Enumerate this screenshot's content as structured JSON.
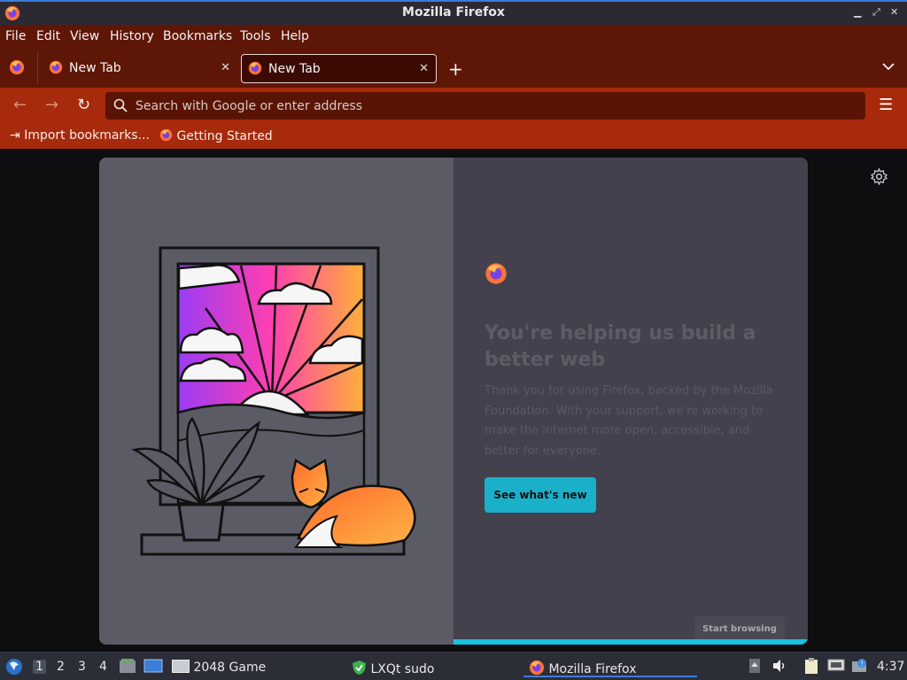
{
  "window": {
    "title": "Mozilla Firefox",
    "controls": [
      "minimize",
      "maximize",
      "close"
    ]
  },
  "menu": [
    "File",
    "Edit",
    "View",
    "History",
    "Bookmarks",
    "Tools",
    "Help"
  ],
  "tabs": [
    {
      "label": "New Tab",
      "active": false
    },
    {
      "label": "New Tab",
      "active": true
    }
  ],
  "urlbar": {
    "placeholder": "Search with Google or enter address",
    "value": ""
  },
  "bookmarks": [
    {
      "label": "Import bookmarks...",
      "icon": "import-icon"
    },
    {
      "label": "Getting Started",
      "icon": "firefox-icon"
    }
  ],
  "onboarding": {
    "headline": "You're helping us build a better web",
    "body": "Thank you for using Firefox, backed by the Mozilla Foundation. With your support, we're working to make the internet more open, accessible, and better for everyone.",
    "cta": "See what's new",
    "skip": "Start browsing",
    "progress": 1.0
  },
  "taskbar": {
    "desktops": [
      "1",
      "2",
      "3",
      "4"
    ],
    "active_desktop": "1",
    "tasks": [
      {
        "label": "2048 Game",
        "icon": "window-icon"
      },
      {
        "label": "LXQt sudo",
        "icon": "shield-icon"
      },
      {
        "label": "Mozilla Firefox",
        "icon": "firefox-icon",
        "active": true
      }
    ],
    "clock": "4:37"
  },
  "colors": {
    "accent": "#1bb0ca",
    "toolbar": "#a62a0b",
    "tabstrip": "#5e1607"
  }
}
